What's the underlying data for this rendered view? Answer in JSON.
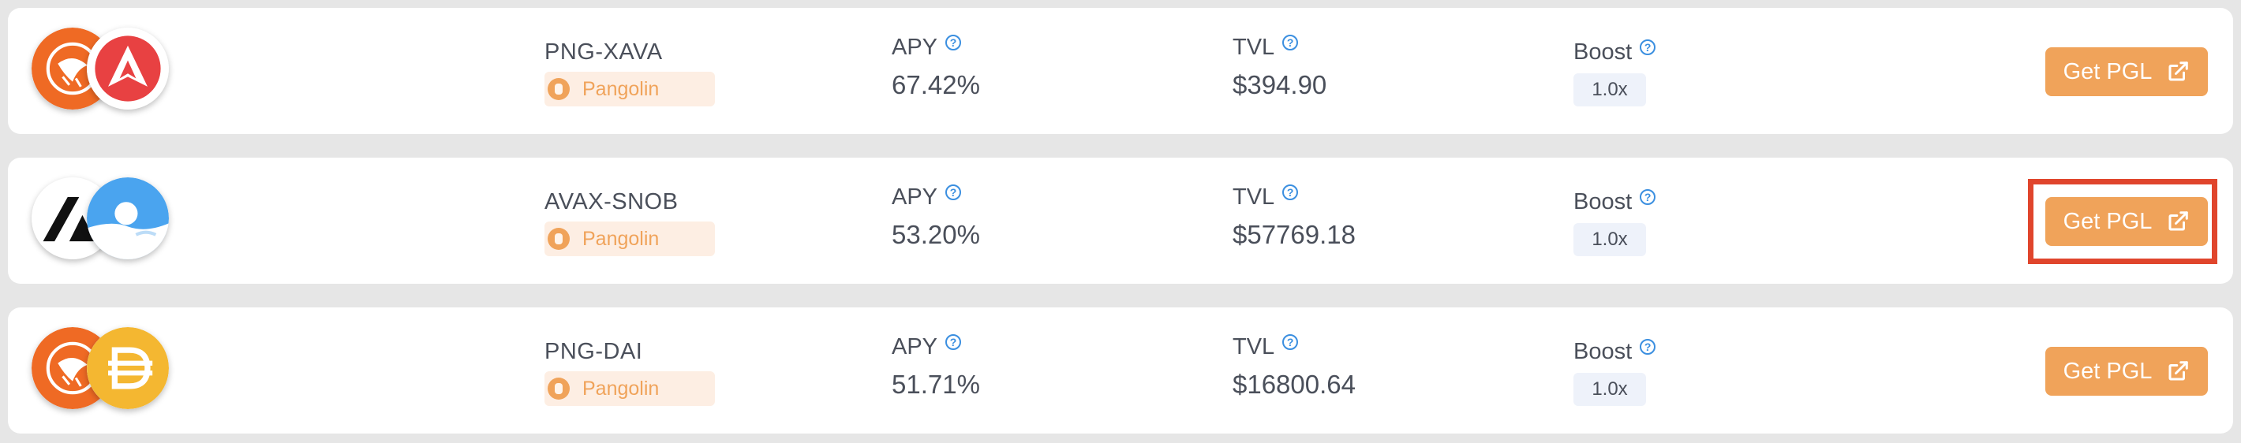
{
  "colors": {
    "accent": "#f0a35a",
    "tag_bg": "#fdeee3",
    "badge_bg": "#eef2fa",
    "help_icon": "#3b8fe0",
    "highlight": "#e0452c"
  },
  "pools": [
    {
      "pair": "PNG-XAVA",
      "dex": "Pangolin",
      "apy_label": "APY",
      "apy": "67.42%",
      "tvl_label": "TVL",
      "tvl": "$394.90",
      "boost_label": "Boost",
      "boost": "1.0x",
      "button_label": "Get PGL",
      "token_icons": [
        "pangolin-icon",
        "xava-icon"
      ]
    },
    {
      "pair": "AVAX-SNOB",
      "dex": "Pangolin",
      "apy_label": "APY",
      "apy": "53.20%",
      "tvl_label": "TVL",
      "tvl": "$57769.18",
      "boost_label": "Boost",
      "boost": "1.0x",
      "button_label": "Get PGL",
      "token_icons": [
        "avax-icon",
        "snob-icon"
      ],
      "highlighted": true
    },
    {
      "pair": "PNG-DAI",
      "dex": "Pangolin",
      "apy_label": "APY",
      "apy": "51.71%",
      "tvl_label": "TVL",
      "tvl": "$16800.64",
      "boost_label": "Boost",
      "boost": "1.0x",
      "button_label": "Get PGL",
      "token_icons": [
        "pangolin-icon",
        "dai-icon"
      ]
    }
  ]
}
